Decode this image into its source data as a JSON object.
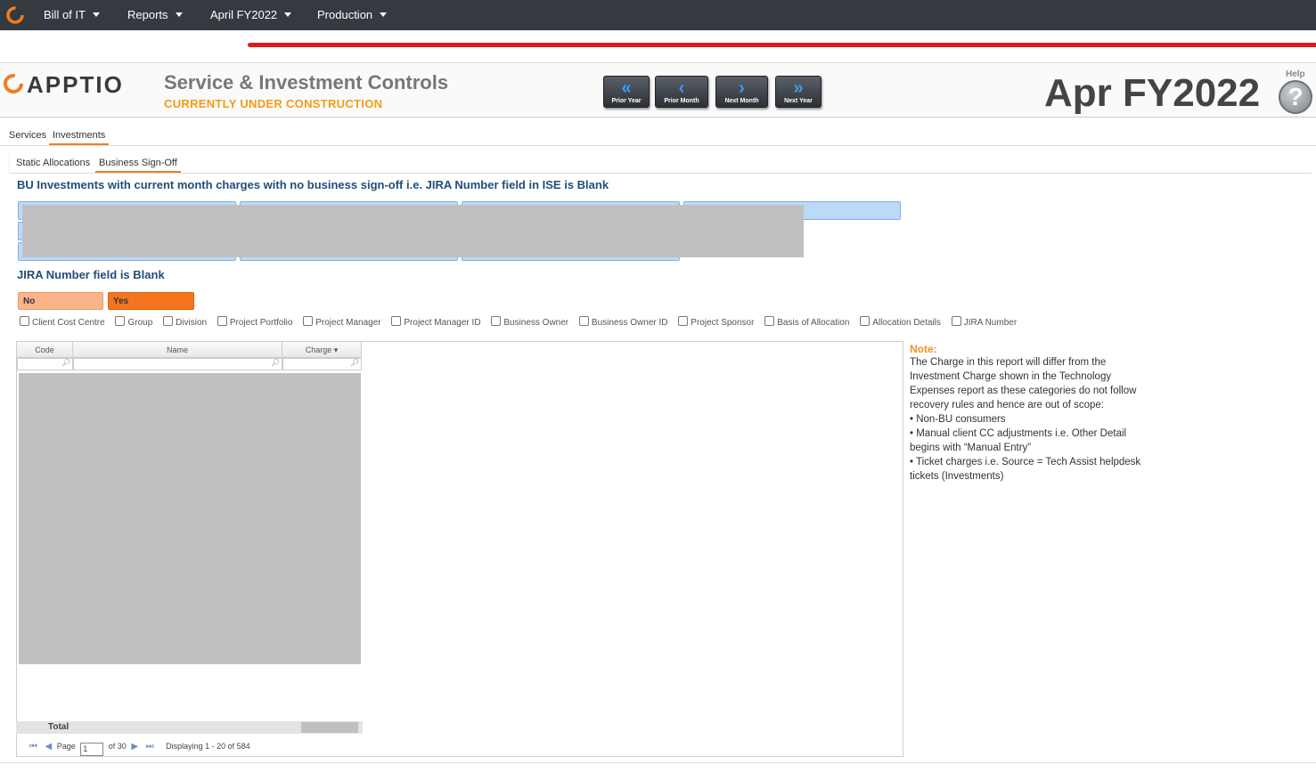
{
  "topbar": {
    "menus": [
      {
        "label": "Bill of IT"
      },
      {
        "label": "Reports"
      },
      {
        "label": "April FY2022"
      },
      {
        "label": "Production"
      }
    ]
  },
  "header": {
    "brand": "APPTIO",
    "title": "Service & Investment Controls",
    "subtitle": "CURRENTLY UNDER CONSTRUCTION",
    "nav": {
      "prior_year": "Prior Year",
      "prior_month": "Prior Month",
      "next_month": "Next Month",
      "next_year": "Next Year"
    },
    "period": "Apr FY2022",
    "help_label": "Help",
    "help_glyph": "?"
  },
  "tabs": {
    "main": [
      "Services",
      "Investments"
    ],
    "sub": [
      "Static Allocations",
      "Business Sign-Off"
    ]
  },
  "report": {
    "title": "BU Investments with current month charges with no business sign-off i.e. JIRA Number field in ISE is Blank",
    "jira_heading": "JIRA Number field is Blank",
    "toggle_no": "No",
    "toggle_yes": "Yes",
    "columns_options": [
      "Client Cost Centre",
      "Group",
      "Division",
      "Project Portfolio",
      "Project Manager",
      "Project Manager ID",
      "Business Owner",
      "Business Owner ID",
      "Project Sponsor",
      "Basis of Allocation",
      "Allocation Details",
      "JIRA Number"
    ]
  },
  "grid": {
    "headers": {
      "code": "Code",
      "name": "Name",
      "charge": "Charge ▾"
    },
    "total_label": "Total",
    "pager": {
      "page_label": "Page",
      "page_value": "1",
      "of_label": "of 30",
      "displaying": "Displaying 1 - 20 of 584"
    }
  },
  "note": {
    "title": "Note:",
    "lines": [
      "The Charge in this report will differ from the",
      "Investment Charge shown in the Technology",
      "Expenses report as these categories do not follow",
      "recovery rules and hence are out of scope:",
      "• Non-BU consumers",
      "• Manual client CC adjustments i.e. Other Detail",
      "begins with “Manual Entry”",
      "• Ticket charges i.e. Source = Tech Assist helpdesk",
      "tickets (Investments)"
    ]
  },
  "colors": {
    "accent": "#f47b20",
    "topbar": "#343a40",
    "title_blue": "#1f4e79",
    "toggle_no": "#fbb48a",
    "toggle_yes": "#f5741e"
  }
}
